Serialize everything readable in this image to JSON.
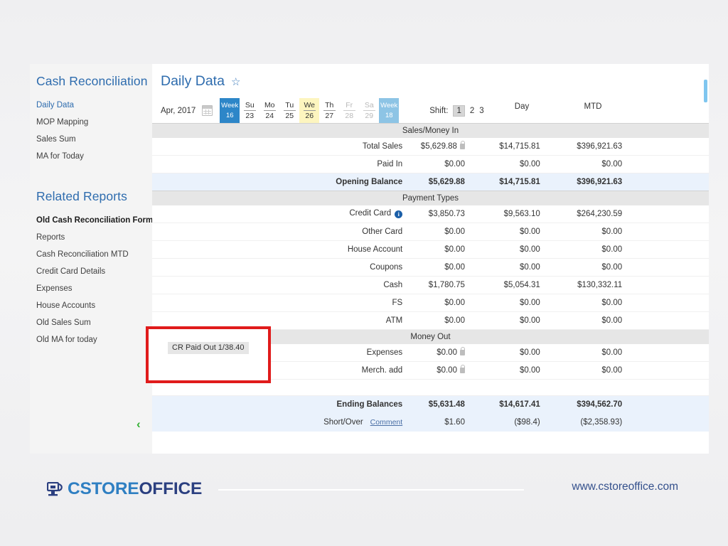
{
  "sidebar": {
    "heading1": "Cash Reconciliation",
    "items": [
      {
        "label": "Daily Data",
        "state": "active"
      },
      {
        "label": "MOP Mapping",
        "state": "normal"
      },
      {
        "label": "Sales Sum",
        "state": "normal"
      },
      {
        "label": "MA for Today",
        "state": "normal"
      }
    ],
    "heading2": "Related Reports",
    "related": [
      {
        "label": "Old Cash Reconciliation Form",
        "state": "bold"
      },
      {
        "label": "Reports",
        "state": "normal"
      },
      {
        "label": "Cash Reconciliation MTD",
        "state": "normal"
      },
      {
        "label": "Credit Card Details",
        "state": "normal"
      },
      {
        "label": "Expenses",
        "state": "normal"
      },
      {
        "label": "House Accounts",
        "state": "normal"
      },
      {
        "label": "Old Sales Sum",
        "state": "normal"
      },
      {
        "label": "Old MA for today",
        "state": "normal"
      }
    ],
    "collapse_icon": "‹"
  },
  "header": {
    "title": "Daily Data",
    "favorite_icon": "☆"
  },
  "toolbar": {
    "month": "Apr, 2017",
    "calendar_icon": "calendar-icon",
    "week_prev": {
      "top": "Week",
      "bottom": "16"
    },
    "week_next": {
      "top": "Week",
      "bottom": "18"
    },
    "days": [
      {
        "dow": "Su",
        "num": "23",
        "state": "normal"
      },
      {
        "dow": "Mo",
        "num": "24",
        "state": "normal"
      },
      {
        "dow": "Tu",
        "num": "25",
        "state": "normal"
      },
      {
        "dow": "We",
        "num": "26",
        "state": "selected"
      },
      {
        "dow": "Th",
        "num": "27",
        "state": "normal"
      },
      {
        "dow": "Fr",
        "num": "28",
        "state": "disabled"
      },
      {
        "dow": "Sa",
        "num": "29",
        "state": "disabled"
      }
    ],
    "shift_label": "Shift:",
    "shifts": [
      {
        "label": "1",
        "selected": true
      },
      {
        "label": "2",
        "selected": false
      },
      {
        "label": "3",
        "selected": false
      }
    ]
  },
  "columns": {
    "shift": "",
    "day": "Day",
    "mtd": "MTD"
  },
  "sections": {
    "sales_money_in": "Sales/Money In",
    "payment_types": "Payment Types",
    "money_out": "Money Out"
  },
  "rows": {
    "total_sales": {
      "label": "Total Sales",
      "shift": "$5,629.88",
      "day": "$14,715.81",
      "mtd": "$396,921.63",
      "locked": true
    },
    "paid_in": {
      "label": "Paid In",
      "shift": "$0.00",
      "day": "$0.00",
      "mtd": "$0.00"
    },
    "opening_balance": {
      "label": "Opening Balance",
      "shift": "$5,629.88",
      "day": "$14,715.81",
      "mtd": "$396,921.63"
    },
    "credit_card": {
      "label": "Credit Card",
      "shift": "$3,850.73",
      "day": "$9,563.10",
      "mtd": "$264,230.59",
      "info": true
    },
    "other_card": {
      "label": "Other Card",
      "shift": "$0.00",
      "day": "$0.00",
      "mtd": "$0.00"
    },
    "house_account": {
      "label": "House Account",
      "shift": "$0.00",
      "day": "$0.00",
      "mtd": "$0.00"
    },
    "coupons": {
      "label": "Coupons",
      "shift": "$0.00",
      "day": "$0.00",
      "mtd": "$0.00"
    },
    "cash": {
      "label": "Cash",
      "shift": "$1,780.75",
      "day": "$5,054.31",
      "mtd": "$130,332.11"
    },
    "fs": {
      "label": "FS",
      "shift": "$0.00",
      "day": "$0.00",
      "mtd": "$0.00"
    },
    "atm": {
      "label": "ATM",
      "shift": "$0.00",
      "day": "$0.00",
      "mtd": "$0.00"
    },
    "expenses": {
      "label": "Expenses",
      "shift": "$0.00",
      "day": "$0.00",
      "mtd": "$0.00",
      "locked": true
    },
    "merch_add": {
      "label": "Merch. add",
      "shift": "$0.00",
      "day": "$0.00",
      "mtd": "$0.00",
      "locked": true
    },
    "ending_balances": {
      "label": "Ending Balances",
      "shift": "$5,631.48",
      "day": "$14,617.41",
      "mtd": "$394,562.70"
    },
    "short_over": {
      "label": "Short/Over",
      "comment": "Comment",
      "shift": "$1.60",
      "day": "($98.4)",
      "mtd": "($2,358.93)"
    }
  },
  "tooltip": {
    "text": "CR Paid Out 1/38.40"
  },
  "footer": {
    "logo_part1": "CSTORE",
    "logo_part2": "OFFICE",
    "url": "www.cstoreoffice.com"
  },
  "colors": {
    "accent_blue": "#2e6cae",
    "week_active": "#2d86c8",
    "week_light": "#8dc4e5",
    "today_yellow": "#fdf5bf",
    "callout_red": "#e01b1b",
    "chevron_green": "#35b135",
    "total_row_bg": "#eaf2fc",
    "section_bg": "#e6e6e6"
  }
}
